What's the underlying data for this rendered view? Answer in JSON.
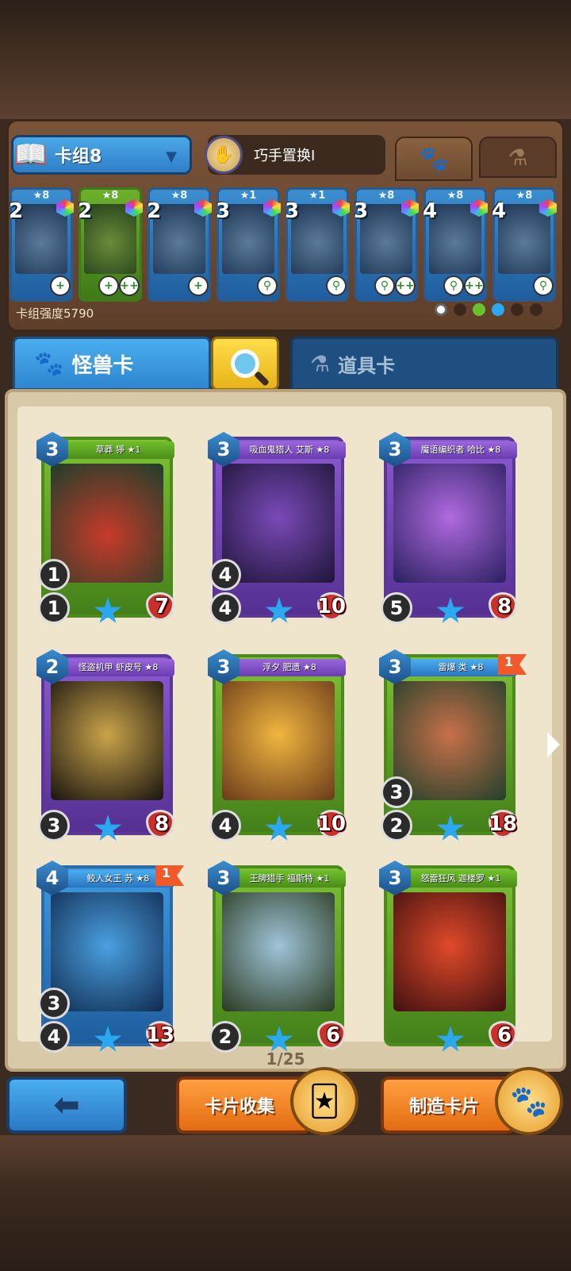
{
  "header": {
    "deck_name": "卡组8",
    "swap_label": "巧手置换I",
    "tabs": [
      "monster",
      "item"
    ]
  },
  "deck": {
    "strength_label": "卡组强度5790",
    "cards": [
      {
        "cost": "2",
        "stars": "★8",
        "color": "blue",
        "abilities": [
          "+"
        ]
      },
      {
        "cost": "2",
        "stars": "★8",
        "color": "green",
        "abilities": [
          "+",
          "++"
        ]
      },
      {
        "cost": "2",
        "stars": "★8",
        "color": "blue",
        "abilities": [
          "+"
        ]
      },
      {
        "cost": "3",
        "stars": "★1",
        "color": "blue",
        "abilities": [
          "⚲"
        ]
      },
      {
        "cost": "3",
        "stars": "★1",
        "color": "blue",
        "abilities": [
          "⚲"
        ]
      },
      {
        "cost": "3",
        "stars": "★8",
        "color": "blue",
        "abilities": [
          "⚲",
          "++"
        ]
      },
      {
        "cost": "4",
        "stars": "★8",
        "color": "blue",
        "abilities": [
          "⚲",
          "++"
        ]
      },
      {
        "cost": "4",
        "stars": "★8",
        "color": "blue",
        "abilities": [
          "⚲"
        ]
      }
    ]
  },
  "categories": {
    "monster_label": "怪兽卡",
    "item_label": "道具卡"
  },
  "cards": [
    {
      "name": "草莽 猙 ★1",
      "cost": "3",
      "top": "1",
      "atk": "1",
      "hp": "7",
      "flag": ""
    },
    {
      "name": "吸血鬼猎人 艾斯 ★8",
      "cost": "3",
      "top": "4",
      "atk": "4",
      "hp": "10",
      "flag": ""
    },
    {
      "name": "魔语编织者 哈比 ★8",
      "cost": "3",
      "top": "",
      "atk": "5",
      "hp": "8",
      "flag": ""
    },
    {
      "name": "怪盗机甲 虾皮号 ★8",
      "cost": "2",
      "top": "",
      "atk": "3",
      "hp": "8",
      "flag": ""
    },
    {
      "name": "浮夕 肥遗 ★8",
      "cost": "3",
      "top": "",
      "atk": "4",
      "hp": "10",
      "flag": ""
    },
    {
      "name": "雷爆 类 ★8",
      "cost": "3",
      "top": "3",
      "atk": "2",
      "hp": "18",
      "flag": "1"
    },
    {
      "name": "鲛人女王 苏 ★8",
      "cost": "4",
      "top": "3",
      "atk": "4",
      "hp": "13",
      "flag": "1"
    },
    {
      "name": "王牌猎手 福斯特 ★1",
      "cost": "3",
      "top": "",
      "atk": "2",
      "hp": "6",
      "flag": ""
    },
    {
      "name": "怒雷狂风 迦楼罗 ★1",
      "cost": "3",
      "top": "",
      "atk": "",
      "hp": "6",
      "flag": ""
    }
  ],
  "pagination": "1/25",
  "buttons": {
    "collect_label": "卡片收集",
    "craft_label": "制造卡片"
  },
  "colors": {
    "accent_blue": "#2f86cf",
    "accent_orange": "#e26b12",
    "book_page": "#efe5cc"
  }
}
